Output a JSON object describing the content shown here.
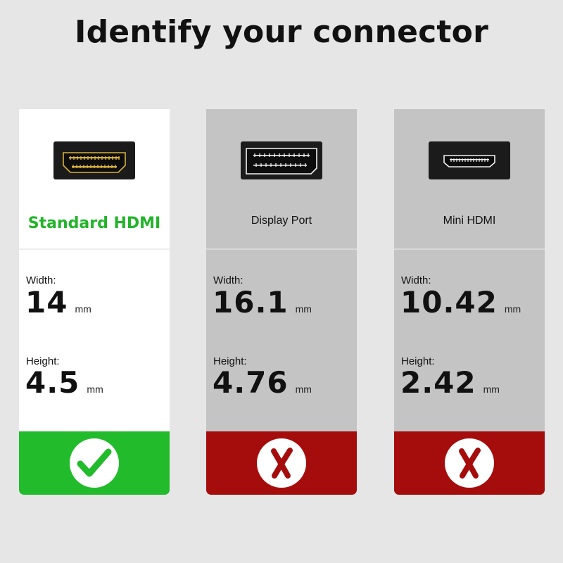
{
  "title": "Identify your connector",
  "colors": {
    "background": "#e6e6e6",
    "accent_green": "#22bb2c",
    "reject_red": "#a50d0d",
    "card_gray": "#c4c4c4"
  },
  "connectors": [
    {
      "name": "Standard HDMI",
      "icon": "hdmi-port-icon",
      "width_label": "Width:",
      "width_value": "14",
      "width_unit": "mm",
      "height_label": "Height:",
      "height_value": "4.5",
      "height_unit": "mm",
      "status": "compatible",
      "status_icon": "checkmark-icon"
    },
    {
      "name": "Display Port",
      "icon": "displayport-icon",
      "width_label": "Width:",
      "width_value": "16.1",
      "width_unit": "mm",
      "height_label": "Height:",
      "height_value": "4.76",
      "height_unit": "mm",
      "status": "incompatible",
      "status_icon": "cross-icon"
    },
    {
      "name": "Mini HDMI",
      "icon": "mini-hdmi-port-icon",
      "width_label": "Width:",
      "width_value": "10.42",
      "width_unit": "mm",
      "height_label": "Height:",
      "height_value": "2.42",
      "height_unit": "mm",
      "status": "incompatible",
      "status_icon": "cross-icon"
    }
  ]
}
